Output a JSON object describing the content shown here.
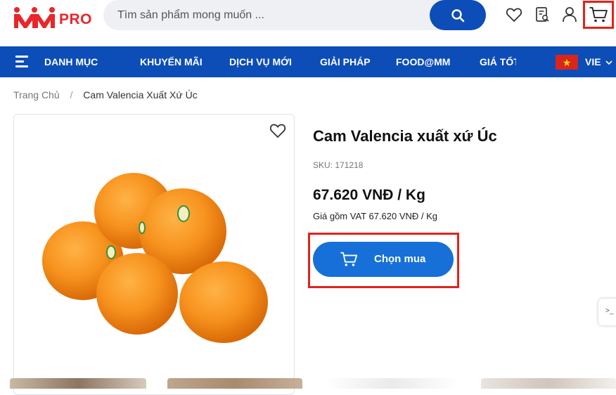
{
  "header": {
    "logo_text": "PRO",
    "search_placeholder": "Tìm sản phẩm mong muốn ...",
    "icons": [
      "heart-icon",
      "order-list-icon",
      "user-icon",
      "cart-icon"
    ]
  },
  "nav": {
    "menu_label": "DANH MỤC",
    "items": [
      "KHUYẾN MÃI",
      "DỊCH VỤ MỚI",
      "GIẢI PHÁP",
      "FOOD@MM",
      "GIÁ TỐT"
    ],
    "language": "VIE"
  },
  "breadcrumb": {
    "home": "Trang Chủ",
    "separator": "/",
    "current": "Cam Valencia Xuất Xứ Úc"
  },
  "product": {
    "title": "Cam Valencia xuất xứ Úc",
    "sku": "SKU: 171218",
    "price": "67.620 VNĐ / Kg",
    "vat_note": "Giá gồm VAT 67.620 VNĐ / Kg",
    "buy_label": "Chọn mua"
  },
  "side_widget": ">_",
  "colors": {
    "brand_blue": "#0c4db8",
    "button_blue": "#1670d8",
    "highlight_red": "#e2231a",
    "logo_red": "#e8262b"
  }
}
